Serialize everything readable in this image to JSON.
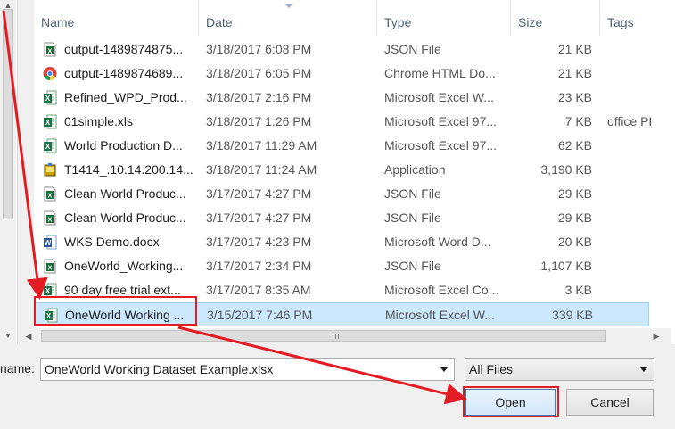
{
  "columns": {
    "name": "Name",
    "date": "Date",
    "type": "Type",
    "size": "Size",
    "tags": "Tags"
  },
  "files": [
    {
      "icon": "json-file-icon",
      "name": "output-1489874875...",
      "date": "3/18/2017 6:08 PM",
      "type": "JSON File",
      "size": "21 KB",
      "tags": ""
    },
    {
      "icon": "chrome-html-icon",
      "name": "output-1489874689...",
      "date": "3/18/2017 6:05 PM",
      "type": "Chrome HTML Do...",
      "size": "21 KB",
      "tags": ""
    },
    {
      "icon": "excel-file-icon",
      "name": "Refined_WPD_Prod...",
      "date": "3/18/2017 2:16 PM",
      "type": "Microsoft Excel W...",
      "size": "23 KB",
      "tags": ""
    },
    {
      "icon": "excel-97-file-icon",
      "name": "01simple.xls",
      "date": "3/18/2017 1:26 PM",
      "type": "Microsoft Excel 97...",
      "size": "7 KB",
      "tags": "office PI"
    },
    {
      "icon": "excel-97-file-icon",
      "name": "World Production D...",
      "date": "3/18/2017 11:29 AM",
      "type": "Microsoft Excel 97...",
      "size": "62 KB",
      "tags": ""
    },
    {
      "icon": "application-icon",
      "name": "T1414_.10.14.200.14...",
      "date": "3/18/2017 11:24 AM",
      "type": "Application",
      "size": "3,190 KB",
      "tags": ""
    },
    {
      "icon": "json-file-icon",
      "name": "Clean World Produc...",
      "date": "3/17/2017 4:27 PM",
      "type": "JSON File",
      "size": "29 KB",
      "tags": ""
    },
    {
      "icon": "json-file-icon",
      "name": "Clean World Produc...",
      "date": "3/17/2017 4:27 PM",
      "type": "JSON File",
      "size": "29 KB",
      "tags": ""
    },
    {
      "icon": "word-file-icon",
      "name": "WKS Demo.docx",
      "date": "3/17/2017 4:23 PM",
      "type": "Microsoft Word D...",
      "size": "20 KB",
      "tags": ""
    },
    {
      "icon": "json-file-icon",
      "name": "OneWorld_Working...",
      "date": "3/17/2017 2:34 PM",
      "type": "JSON File",
      "size": "1,107 KB",
      "tags": ""
    },
    {
      "icon": "excel-csv-file-icon",
      "name": "90 day free trial ext...",
      "date": "3/17/2017 8:35 AM",
      "type": "Microsoft Excel Co...",
      "size": "3 KB",
      "tags": ""
    },
    {
      "icon": "excel-file-icon",
      "name": "OneWorld Working ...",
      "date": "3/15/2017 7:46 PM",
      "type": "Microsoft Excel W...",
      "size": "339 KB",
      "tags": "",
      "selected": true
    }
  ],
  "filename": {
    "label": "name:",
    "value": "OneWorld Working Dataset Example.xlsx"
  },
  "filter": {
    "value": "All Files"
  },
  "buttons": {
    "open": "Open",
    "cancel": "Cancel"
  },
  "colors": {
    "selection": "#cce8ff",
    "annotation": "#e31b23",
    "header_text": "#4c607a"
  }
}
